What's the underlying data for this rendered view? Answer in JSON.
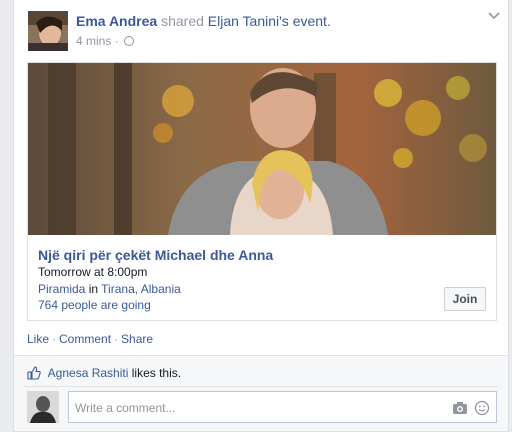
{
  "post": {
    "author": "Ema Andrea",
    "verb": "shared",
    "event_owner": "Eljan Tanini's",
    "event_word": "event.",
    "time": "4 mins",
    "time_sep": "·",
    "privacy_icon": "globe-icon"
  },
  "event": {
    "title": "Një qiri për çekët Michael dhe Anna",
    "time": "Tomorrow at 8:00pm",
    "venue": "Piramida",
    "in_word": "in",
    "city": "Tirana, Albania",
    "going": "764 people are going",
    "join_label": "Join"
  },
  "actions": {
    "like": "Like",
    "comment": "Comment",
    "share": "Share",
    "sep": "·"
  },
  "footer": {
    "liker": "Agnesa Rashiti",
    "likes_text": "likes this.",
    "comment_placeholder": "Write a comment..."
  },
  "colors": {
    "link": "#3b5998",
    "muted": "#9197a3",
    "text": "#141823"
  }
}
